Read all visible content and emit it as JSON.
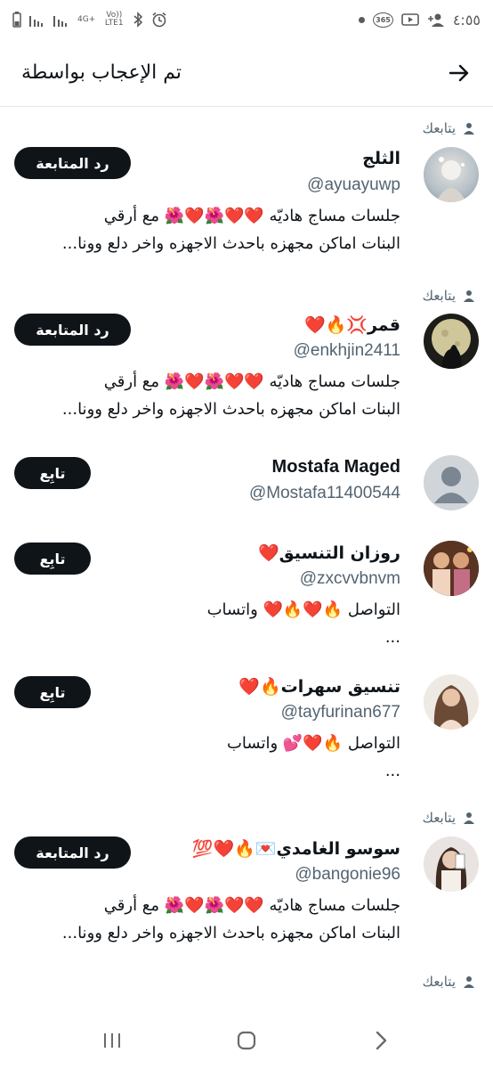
{
  "status_bar": {
    "time": "٤:٥٥",
    "network_label": "4G+",
    "volte_label": "Vo)) LTE1",
    "badge_365": "365"
  },
  "header": {
    "title": "تم الإعجاب بواسطة"
  },
  "users": [
    {
      "follows_you": "يتابعك",
      "name": "الثلج",
      "handle": "@ayuayuwp",
      "bio_line1": "جلسات مساج هاديّه ❤️❤️🌺❤️🌺 مع أرقي",
      "bio_line2": "البنات اماكن مجهزه باحدث الاجهزه واخر دلع وونا...",
      "button": "رد المتابعة"
    },
    {
      "follows_you": "يتابعك",
      "name": "قمر💢🔥❤️",
      "handle": "@enkhjin2411",
      "bio_line1": "جلسات مساج هاديّه ❤️❤️🌺❤️🌺 مع أرقي",
      "bio_line2": "البنات اماكن مجهزه باحدث الاجهزه واخر دلع وونا...",
      "button": "رد المتابعة"
    },
    {
      "name": "Mostafa Maged",
      "handle": "@Mostafa11400544",
      "button": "تابِع"
    },
    {
      "name": "روزان التنسيق❤️",
      "handle": "@zxcvvbnvm",
      "bio_line1": "التواصل 🔥❤️🔥❤️ واتساب",
      "bio_line2": "...",
      "button": "تابِع"
    },
    {
      "name": "تنسيق سهرات🔥❤️",
      "handle": "@tayfurinan677",
      "bio_line1": "التواصل 🔥❤️💕 واتساب",
      "bio_line2": "...",
      "button": "تابِع"
    },
    {
      "follows_you": "يتابعك",
      "name": "سوسو الغامدي💌🔥❤️💯",
      "handle": "@bangonie96",
      "bio_line1": "جلسات مساج هاديّه ❤️❤️🌺❤️🌺 مع أرقي",
      "bio_line2": "البنات اماكن مجهزه باحدث الاجهزه واخر دلع وونا...",
      "button": "رد المتابعة"
    },
    {
      "follows_you": "يتابعك"
    }
  ],
  "colors": {
    "button_bg": "#0f1419",
    "secondary_text": "#536471",
    "divider": "#e7e9ea"
  }
}
